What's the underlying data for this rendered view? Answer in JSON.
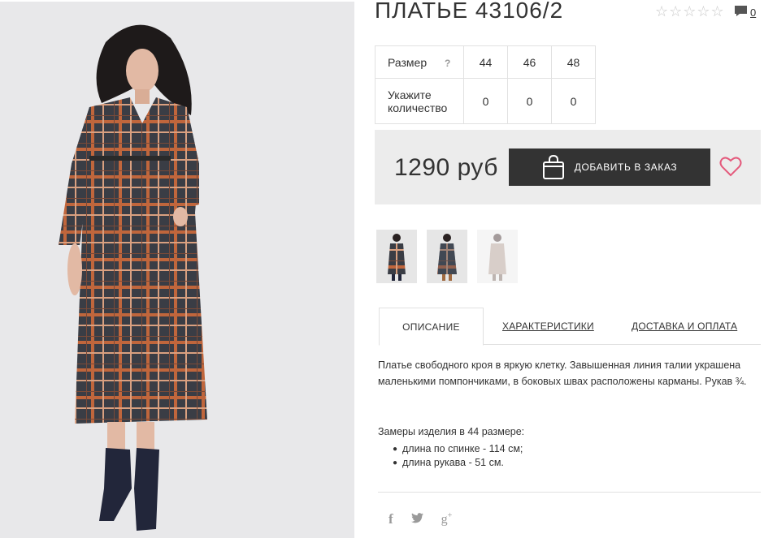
{
  "product": {
    "title": "ПЛАТЬЕ 43106/2",
    "rating_stars": "☆☆☆☆☆",
    "comments_count": "0"
  },
  "size_table": {
    "size_label": "Размер",
    "help": "?",
    "sizes": [
      "44",
      "46",
      "48"
    ],
    "quantity_label": "Укажите количество",
    "quantities": [
      "0",
      "0",
      "0"
    ]
  },
  "order": {
    "price": "1290 руб",
    "add_button_label": "ДОБАВИТЬ В ЗАКАЗ"
  },
  "tabs": [
    {
      "label": "ОПИСАНИЕ",
      "active": true
    },
    {
      "label": "ХАРАКТЕРИСТИКИ",
      "active": false
    },
    {
      "label": "ДОСТАВКА И ОПЛАТА",
      "active": false
    }
  ],
  "description": {
    "text": "Платье свободного кроя в яркую клетку. Завышенная линия талии украшена маленькими помпончиками, в боковых швах расположены карманы. Рукав ¾.",
    "measures_title": "Замеры изделия в 44 размере:",
    "measures": [
      "длина по спинке - 114 см;",
      "длина рукава - 51 см."
    ]
  },
  "colors": {
    "accent_dark": "#333333",
    "heart": "#e45a7c",
    "price_bar_bg": "#ececec"
  },
  "icons": [
    "comment-icon",
    "help-icon",
    "shopping-bag-icon",
    "heart-icon",
    "facebook-icon",
    "twitter-icon",
    "google-plus-icon"
  ]
}
